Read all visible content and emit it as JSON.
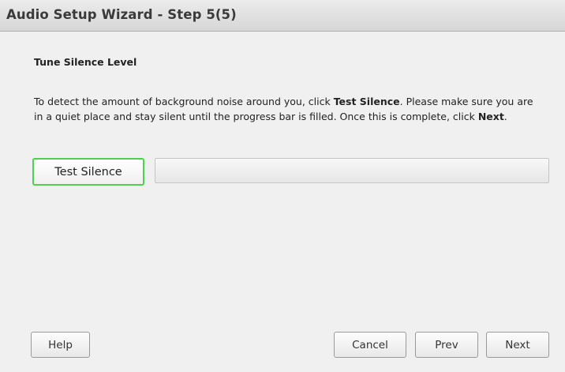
{
  "window": {
    "title": "Audio Setup Wizard - Step 5(5)"
  },
  "content": {
    "heading": "Tune Silence Level",
    "instructions": {
      "part1": "To detect the amount of background noise around you, click ",
      "bold1": "Test Silence",
      "part2": ". Please make sure you are in a quiet place and stay silent until the progress bar is filled. Once this is complete, click ",
      "bold2": "Next",
      "part3": "."
    },
    "test_button_label": "Test Silence",
    "progress": {
      "value_percent": 0,
      "fill_color": "#3fb83f"
    }
  },
  "footer": {
    "help_label": "Help",
    "cancel_label": "Cancel",
    "prev_label": "Prev",
    "next_label": "Next"
  },
  "colors": {
    "focus_border": "#4cd24c",
    "background": "#f0f0f0"
  }
}
